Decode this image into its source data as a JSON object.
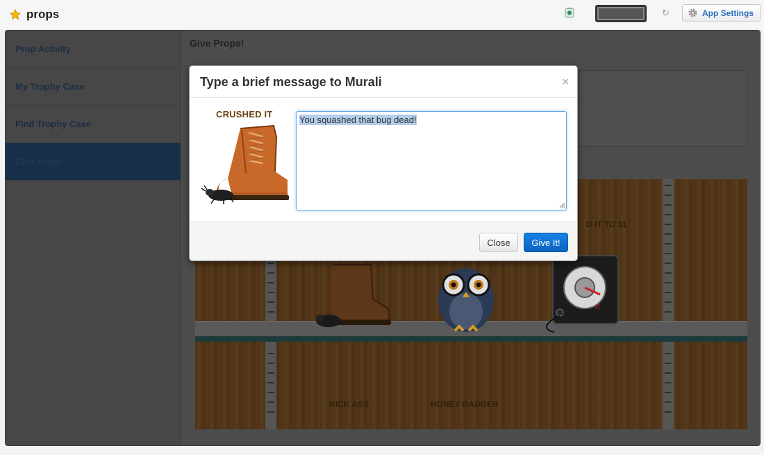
{
  "header": {
    "app_title": "props",
    "settings_label": "App Settings"
  },
  "sidebar": {
    "items": [
      {
        "label": "Prop Activity"
      },
      {
        "label": "My Trophy Case"
      },
      {
        "label": "Find Trophy Case"
      },
      {
        "label": "Give Props"
      }
    ],
    "active_index": 3
  },
  "main": {
    "title": "Give Props!",
    "shelf": {
      "labels": [
        "KICK ASS",
        "HONEY BADGER"
      ],
      "partial_label": "D IT TO 11",
      "knob_number": "11"
    }
  },
  "modal": {
    "title": "Type a brief message to Murali",
    "close_symbol": "×",
    "trophy_name": "CRUSHED IT",
    "message_value": "You squashed that bug dead!",
    "close_button": "Close",
    "submit_button": "Give It!"
  },
  "colors": {
    "accent": "#0c62c0",
    "link": "#2a6fbf",
    "active_nav": "#153048"
  }
}
